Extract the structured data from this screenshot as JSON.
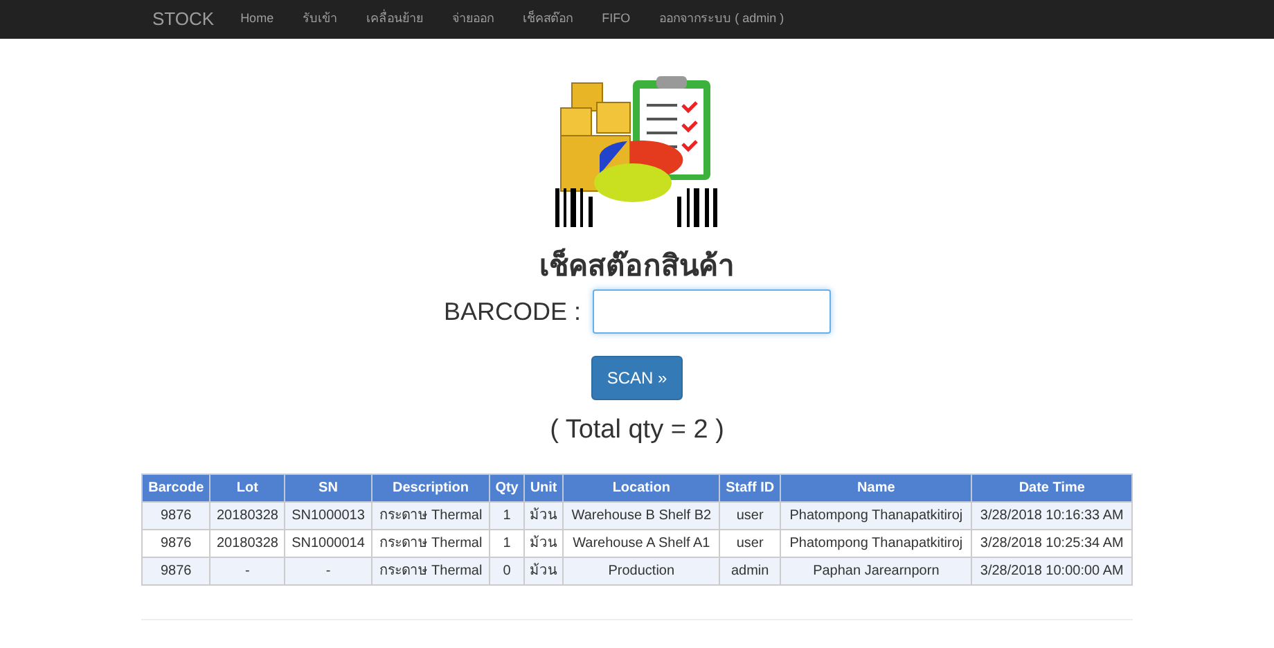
{
  "navbar": {
    "brand": "STOCK",
    "items": [
      {
        "label": "Home"
      },
      {
        "label": "รับเข้า"
      },
      {
        "label": "เคลื่อนย้าย"
      },
      {
        "label": "จ่ายออก"
      },
      {
        "label": "เช็คสต๊อก"
      },
      {
        "label": "FIFO"
      },
      {
        "label": "ออกจากระบบ ( admin )"
      }
    ]
  },
  "heading": "เช็คสต๊อกสินค้า",
  "barcode_field": {
    "label": "BARCODE :",
    "focused": true
  },
  "scan_button": "SCAN »",
  "total": "( Total qty = 2 )",
  "table": {
    "columns": [
      "Barcode",
      "Lot",
      "SN",
      "Description",
      "Qty",
      "Unit",
      "Location",
      "Staff ID",
      "Name",
      "Date Time"
    ],
    "rows": [
      [
        "9876",
        "20180328",
        "SN1000013",
        "กระดาษ Thermal",
        "1",
        "ม้วน",
        "Warehouse B Shelf B2",
        "user",
        "Phatompong Thanapatkitiroj",
        "3/28/2018 10:16:33 AM"
      ],
      [
        "9876",
        "20180328",
        "SN1000014",
        "กระดาษ Thermal",
        "1",
        "ม้วน",
        "Warehouse A Shelf A1",
        "user",
        "Phatompong Thanapatkitiroj",
        "3/28/2018 10:25:34 AM"
      ],
      [
        "9876",
        "-",
        "-",
        "กระดาษ Thermal",
        "0",
        "ม้วน",
        "Production",
        "admin",
        "Paphan Jarearnporn",
        "3/28/2018 10:00:00 AM"
      ]
    ]
  }
}
